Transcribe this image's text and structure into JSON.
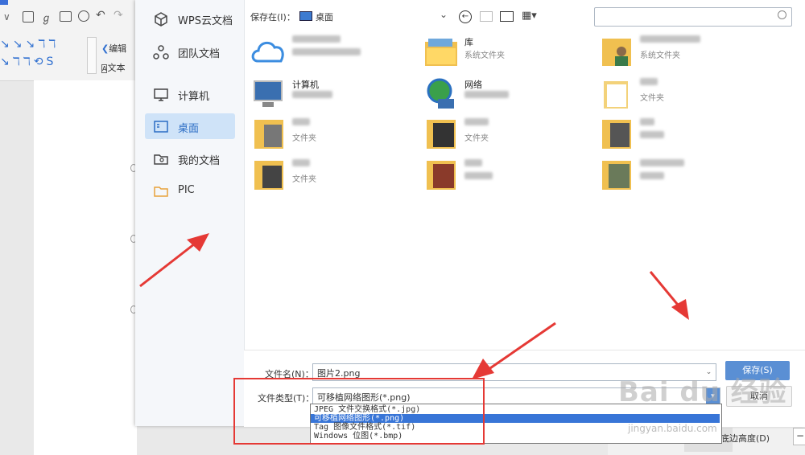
{
  "app": {
    "toolbar_items": [
      "编辑",
      "文本"
    ],
    "right_panel_label": "底边高度(D)"
  },
  "sidebar": {
    "items": [
      {
        "label": "WPS云文档",
        "icon": "cube-icon"
      },
      {
        "label": "团队文档",
        "icon": "team-icon"
      },
      {
        "label": "计算机",
        "icon": "monitor-icon"
      },
      {
        "label": "桌面",
        "icon": "desktop-icon",
        "active": true
      },
      {
        "label": "我的文档",
        "icon": "my-docs-icon"
      },
      {
        "label": "PIC",
        "icon": "folder-icon"
      }
    ]
  },
  "topbar": {
    "save_in_label": "保存在(I)：",
    "location": "桌面",
    "search_placeholder": ""
  },
  "files": [
    {
      "name": "",
      "sub": "",
      "icon": "cloud-icon"
    },
    {
      "name": "库",
      "sub": "系统文件夹",
      "icon": "library-folder-icon"
    },
    {
      "name": "",
      "sub": "系统文件夹",
      "icon": "user-folder-icon"
    },
    {
      "name": "计算机",
      "sub": "",
      "icon": "computer-icon"
    },
    {
      "name": "网络",
      "sub": "",
      "icon": "network-icon"
    },
    {
      "name": "",
      "sub": "文件夹",
      "icon": "folder-icon"
    },
    {
      "name": "",
      "sub": "文件夹",
      "icon": "folder-icon"
    },
    {
      "name": "",
      "sub": "文件夹",
      "icon": "folder-icon"
    },
    {
      "name": "",
      "sub": "",
      "icon": "folder-icon"
    },
    {
      "name": "",
      "sub": "文件夹",
      "icon": "folder-icon"
    },
    {
      "name": "",
      "sub": "",
      "icon": "folder-icon"
    },
    {
      "name": "",
      "sub": "",
      "icon": "folder-icon"
    }
  ],
  "form": {
    "filename_label": "文件名(N)：",
    "filename_value": "图片2.png",
    "filetype_label": "文件类型(T)：",
    "filetype_value": "可移植网络图形(*.png)",
    "save_label": "保存(S)",
    "cancel_label": "取消"
  },
  "dropdown": {
    "options": [
      "JPEG 文件交换格式(*.jpg)",
      "可移植网络图形(*.png)",
      "Tag 图像文件格式(*.tif)",
      "Windows 位图(*.bmp)"
    ],
    "selected_index": 1
  },
  "watermark": {
    "text": "Bai du 经验",
    "sub": "jingyan.baidu.com"
  },
  "colors": {
    "accent": "#5a8fd4",
    "highlight": "#3875d7",
    "annotation": "#e53935",
    "active_item": "#cfe3f8"
  }
}
